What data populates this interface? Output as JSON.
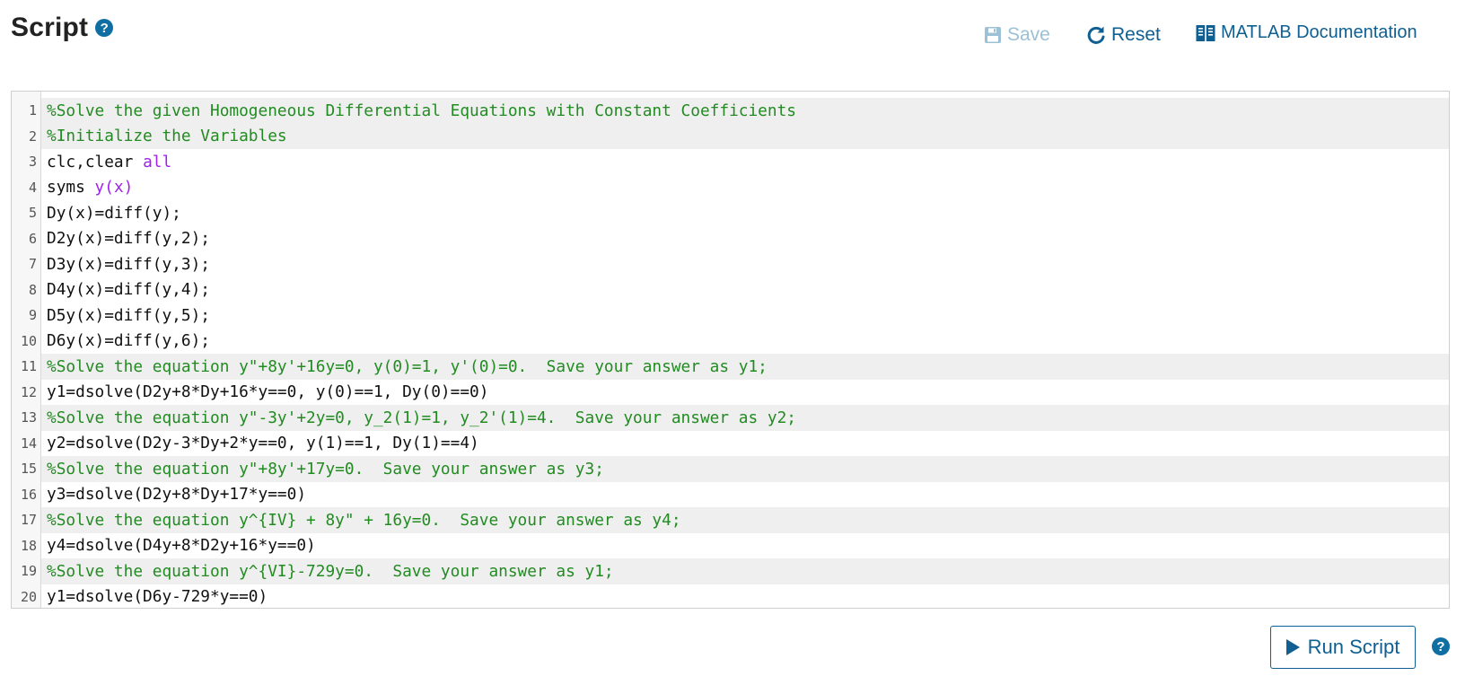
{
  "header": {
    "title": "Script",
    "help_icon": "question-circle-icon"
  },
  "toolbar": {
    "save_label": "Save",
    "save_icon": "floppy-disk-icon",
    "save_enabled": false,
    "reset_label": "Reset",
    "reset_icon": "refresh-icon",
    "docs_label": "MATLAB Documentation",
    "docs_icon": "book-icon"
  },
  "editor": {
    "lines": [
      {
        "n": "1",
        "tokens": [
          {
            "t": "%Solve the given Homogeneous Differential Equations with Constant Coefficients",
            "k": "comment"
          }
        ],
        "hl": true
      },
      {
        "n": "2",
        "tokens": [
          {
            "t": "%Initialize the Variables",
            "k": "comment"
          }
        ],
        "hl": true
      },
      {
        "n": "3",
        "tokens": [
          {
            "t": "clc,clear ",
            "k": "plain"
          },
          {
            "t": "all",
            "k": "kw"
          }
        ],
        "hl": false
      },
      {
        "n": "4",
        "tokens": [
          {
            "t": "syms ",
            "k": "plain"
          },
          {
            "t": "y(x)",
            "k": "kw"
          }
        ],
        "hl": false
      },
      {
        "n": "5",
        "tokens": [
          {
            "t": "Dy(x)=diff(y);",
            "k": "plain"
          }
        ],
        "hl": false
      },
      {
        "n": "6",
        "tokens": [
          {
            "t": "D2y(x)=diff(y,2);",
            "k": "plain"
          }
        ],
        "hl": false
      },
      {
        "n": "7",
        "tokens": [
          {
            "t": "D3y(x)=diff(y,3);",
            "k": "plain"
          }
        ],
        "hl": false
      },
      {
        "n": "8",
        "tokens": [
          {
            "t": "D4y(x)=diff(y,4);",
            "k": "plain"
          }
        ],
        "hl": false
      },
      {
        "n": "9",
        "tokens": [
          {
            "t": "D5y(x)=diff(y,5);",
            "k": "plain"
          }
        ],
        "hl": false
      },
      {
        "n": "10",
        "tokens": [
          {
            "t": "D6y(x)=diff(y,6);",
            "k": "plain"
          }
        ],
        "hl": false
      },
      {
        "n": "11",
        "tokens": [
          {
            "t": "%Solve the equation y\"+8y'+16y=0, y(0)=1, y'(0)=0.  Save your answer as y1;",
            "k": "comment"
          }
        ],
        "hl": true
      },
      {
        "n": "12",
        "tokens": [
          {
            "t": "y1=dsolve(D2y+8*Dy+16*y==0, y(0)==1, Dy(0)==0)",
            "k": "plain"
          }
        ],
        "hl": false
      },
      {
        "n": "13",
        "tokens": [
          {
            "t": "%Solve the equation y\"-3y'+2y=0, y_2(1)=1, y_2'(1)=4.  Save your answer as y2;",
            "k": "comment"
          }
        ],
        "hl": true
      },
      {
        "n": "14",
        "tokens": [
          {
            "t": "y2=dsolve(D2y-3*Dy+2*y==0, y(1)==1, Dy(1)==4)",
            "k": "plain"
          }
        ],
        "hl": false
      },
      {
        "n": "15",
        "tokens": [
          {
            "t": "%Solve the equation y\"+8y'+17y=0.  Save your answer as y3;",
            "k": "comment"
          }
        ],
        "hl": true
      },
      {
        "n": "16",
        "tokens": [
          {
            "t": "y3=dsolve(D2y+8*Dy+17*y==0)",
            "k": "plain"
          }
        ],
        "hl": false
      },
      {
        "n": "17",
        "tokens": [
          {
            "t": "%Solve the equation y^{IV} + 8y\" + 16y=0.  Save your answer as y4;",
            "k": "comment"
          }
        ],
        "hl": true
      },
      {
        "n": "18",
        "tokens": [
          {
            "t": "y4=dsolve(D4y+8*D2y+16*y==0)",
            "k": "plain"
          }
        ],
        "hl": false
      },
      {
        "n": "19",
        "tokens": [
          {
            "t": "%Solve the equation y^{VI}-729y=0.  Save your answer as y1;",
            "k": "comment"
          }
        ],
        "hl": true
      },
      {
        "n": "20",
        "tokens": [
          {
            "t": "y1=dsolve(D6y-729*y==0)",
            "k": "plain"
          }
        ],
        "hl": false
      }
    ]
  },
  "run": {
    "label": "Run Script",
    "icon": "play-icon",
    "help_icon": "question-circle-icon"
  },
  "colors": {
    "accent": "#0f5f92",
    "comment": "#228b22",
    "keyword": "#a020f0",
    "disabled": "#9cc0d6"
  }
}
